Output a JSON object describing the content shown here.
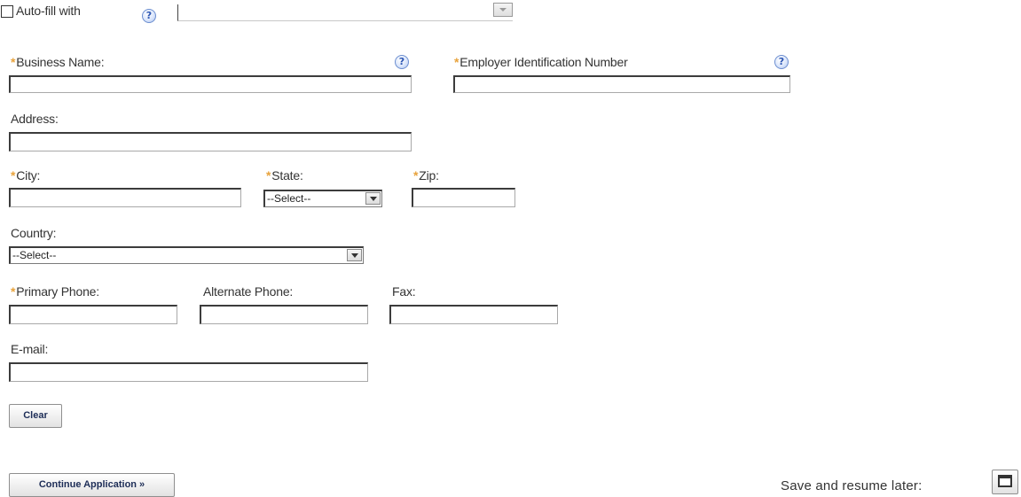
{
  "autofill": {
    "label": "Auto-fill with",
    "checked": false,
    "selected_value": ""
  },
  "fields": {
    "business_name": {
      "label": "Business Name:",
      "required": true,
      "value": ""
    },
    "ein": {
      "label": "Employer Identification Number",
      "required": true,
      "value": ""
    },
    "address": {
      "label": "Address:",
      "required": false,
      "value": ""
    },
    "city": {
      "label": "City:",
      "required": true,
      "value": ""
    },
    "state": {
      "label": "State:",
      "required": true,
      "selected": "--Select--"
    },
    "zip": {
      "label": "Zip:",
      "required": true,
      "value": ""
    },
    "country": {
      "label": "Country:",
      "required": false,
      "selected": "--Select--"
    },
    "primary_phone": {
      "label": "Primary Phone:",
      "required": true,
      "value": ""
    },
    "alternate_phone": {
      "label": "Alternate Phone:",
      "required": false,
      "value": ""
    },
    "fax": {
      "label": "Fax:",
      "required": false,
      "value": ""
    },
    "email": {
      "label": "E-mail:",
      "required": false,
      "value": ""
    }
  },
  "required_marker": "*",
  "help_glyph": "?",
  "buttons": {
    "clear": "Clear",
    "continue": "Continue Application »"
  },
  "save_resume": {
    "label": "Save and resume later:"
  },
  "colors": {
    "required_asterisk": "#e8a33d",
    "help_icon": "#2b55b3",
    "button_text": "#1d2d57"
  }
}
